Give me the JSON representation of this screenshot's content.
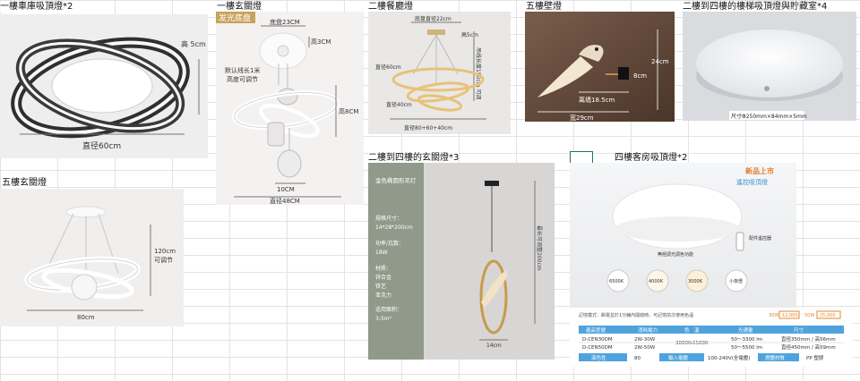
{
  "labels": {
    "l1": "一樓車庫吸頂燈*2",
    "l2": "一樓玄關燈",
    "l3": "二樓餐廳燈",
    "l4": "五樓壁燈",
    "l5": "二樓到四樓的樓梯吸頂燈與貯藏室*4",
    "l6": "五樓玄關燈",
    "l7": "二樓到四樓的玄關燈*3",
    "l8": "四樓客房吸頂燈*2"
  },
  "img1": {
    "height": "高 5cm",
    "diameter": "直径60cm"
  },
  "img2": {
    "badge": "发光底盘",
    "base": "底盘23CM",
    "base_h": "高3CM",
    "note1": "默认线长1米",
    "note2": "高度可调节",
    "height": "高8CM",
    "width": "10CM",
    "diameter": "直径48CM"
  },
  "img3": {
    "base": "底盘直径22cm",
    "base_h": "高5cm",
    "cable": "吊线长度150cm 可调",
    "d60": "直径60cm",
    "d40": "直径40cm",
    "sum": "直径80+60+40cm"
  },
  "img4": {
    "h24": "24cm",
    "h8": "8cm",
    "wall": "离墙18.5cm",
    "w29": "宽29cm"
  },
  "img5": {
    "size": "尺寸Φ250mm×84mm×5mm"
  },
  "img6": {
    "height": "120cm",
    "adjust": "可调节",
    "width": "80cm"
  },
  "img7": {
    "title": "金色椭圆形吊灯",
    "spec_label": "规格尺寸：",
    "spec": "14*28*200cm",
    "power_label": "功率/瓦数：",
    "power": "18W",
    "material_label": "材质：",
    "m1": "锌合金",
    "m2": "铁艺",
    "m3": "亚克力",
    "area_label": "适用面积：",
    "area": "3-5m²",
    "cable": "最长可调整200cm",
    "w14": "14cm"
  },
  "img8": {
    "new_title": "新品上市",
    "subtitle": "遙控吸頂燈",
    "remote_note": "配件遙控器",
    "modes_title": "無極調光調色功能",
    "mode1": "6500K",
    "mode2": "4000K",
    "mode3": "3000K",
    "mode4": "小夜燈",
    "note": "記憶模式：斷電並於1分鐘內開啟時，可記憶前次使用色溫",
    "w30": "30W",
    "p30": "12,000",
    "w50": "50W",
    "p50": "25,000",
    "table": {
      "headers": [
        "產品型號",
        "消耗電力",
        "色　溫",
        "光通量",
        "尺寸"
      ],
      "rows": [
        [
          "D-CEN30DM",
          "2W-30W",
          "3000K-6500K",
          "50～3300 lm",
          "直徑350mm / 高56mm"
        ],
        [
          "D-CEN50DM",
          "2W-50W",
          "",
          "50～5500 lm",
          "直徑450mm / 高59mm"
        ]
      ],
      "footer": [
        "演色性",
        "80",
        "輸入電壓",
        "100-240V(全電壓)",
        "燈體材質",
        "PP 塑膠"
      ]
    }
  }
}
